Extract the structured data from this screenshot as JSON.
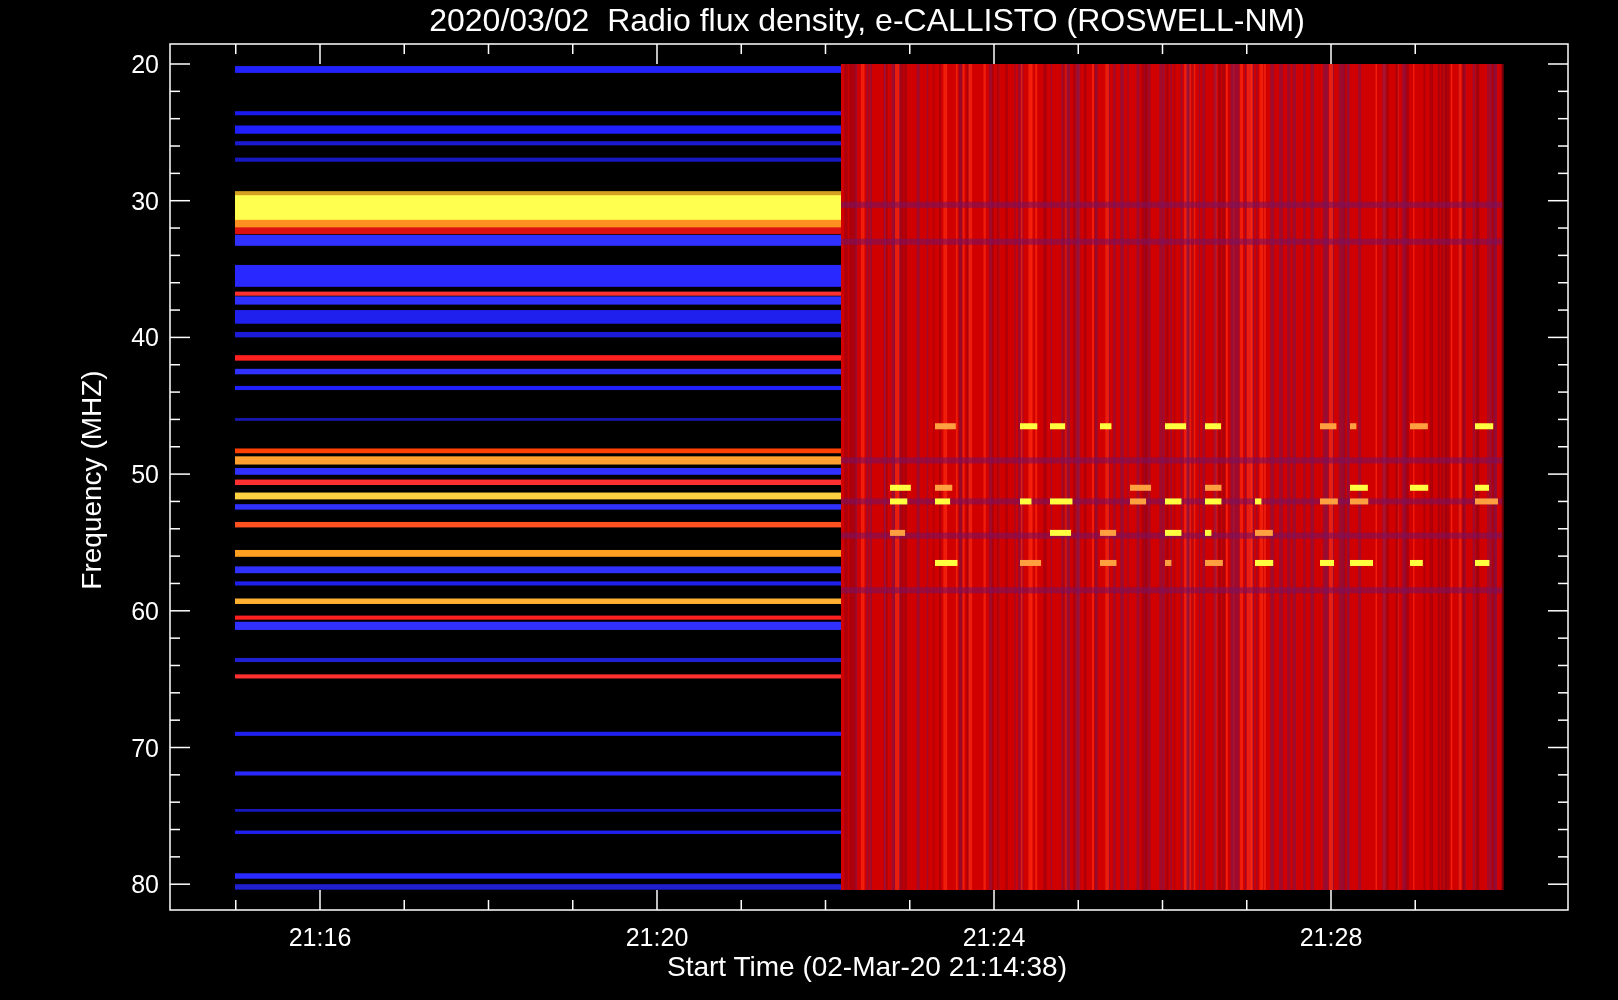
{
  "title": "2020/03/02  Radio flux density, e-CALLISTO (ROSWELL-NM)",
  "y_axis": {
    "label": "Frequency (MHZ)",
    "ticks": [
      "20",
      "30",
      "40",
      "50",
      "60",
      "70",
      "80"
    ]
  },
  "x_axis": {
    "label": "Start Time (02-Mar-20 21:14:38)",
    "ticks": [
      "21:16",
      "21:20",
      "21:24",
      "21:28"
    ]
  }
}
